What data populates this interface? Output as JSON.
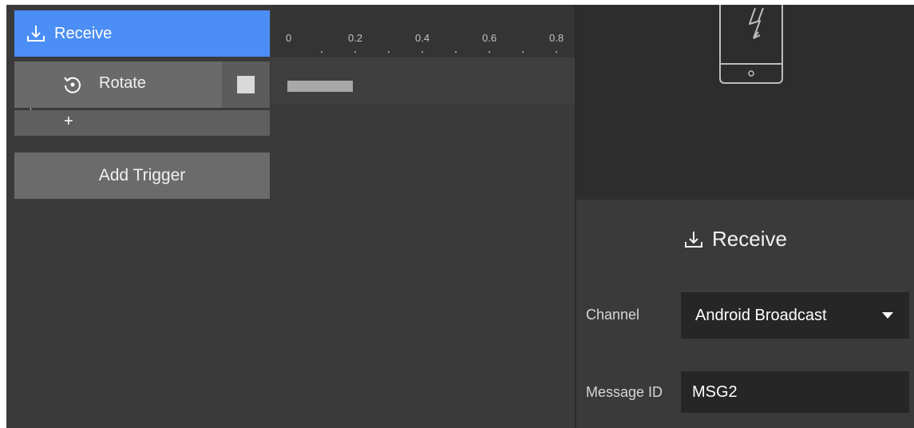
{
  "trigger": {
    "label": "Receive",
    "icon": "receive-icon",
    "color": "#4b8ef5"
  },
  "action": {
    "label": "Rotate",
    "icon": "rotate-icon"
  },
  "add_action": {
    "label": "+"
  },
  "add_trigger": {
    "label": "Add Trigger"
  },
  "timeline": {
    "ticks": [
      "0",
      "0.2",
      "0.4",
      "0.6",
      "0.8"
    ],
    "bar": {
      "start": 0,
      "end": 0.2
    }
  },
  "preview": {
    "icon": "phone-lightning-icon"
  },
  "inspector": {
    "title": "Receive",
    "title_icon": "receive-icon",
    "channel_label": "Channel",
    "channel_value": "Android Broadcast",
    "message_id_label": "Message ID",
    "message_id_value": "MSG2"
  }
}
